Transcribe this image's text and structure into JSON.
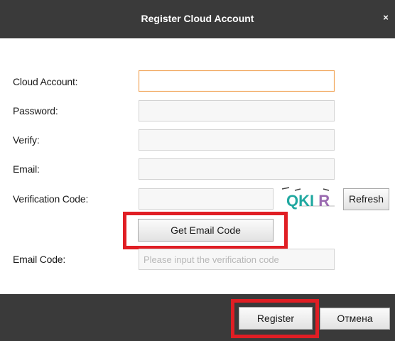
{
  "dialog": {
    "title": "Register Cloud Account",
    "close_glyph": "×"
  },
  "form": {
    "cloud_account_label": "Cloud Account:",
    "password_label": "Password:",
    "verify_label": "Verify:",
    "email_label": "Email:",
    "verification_code_label": "Verification Code:",
    "email_code_label": "Email Code:",
    "email_code_placeholder": "Please input the verification code",
    "captcha_text": "QKI R",
    "refresh_label": "Refresh",
    "get_email_code_label": "Get Email Code"
  },
  "footer": {
    "register_label": "Register",
    "cancel_label": "Отмена"
  },
  "colors": {
    "titlebar": "#3a3a3a",
    "focus_border": "#f0a050",
    "highlight_red": "#e01e24",
    "captcha_teal": "#20a8a0",
    "captcha_purple": "#9a6ab0"
  }
}
